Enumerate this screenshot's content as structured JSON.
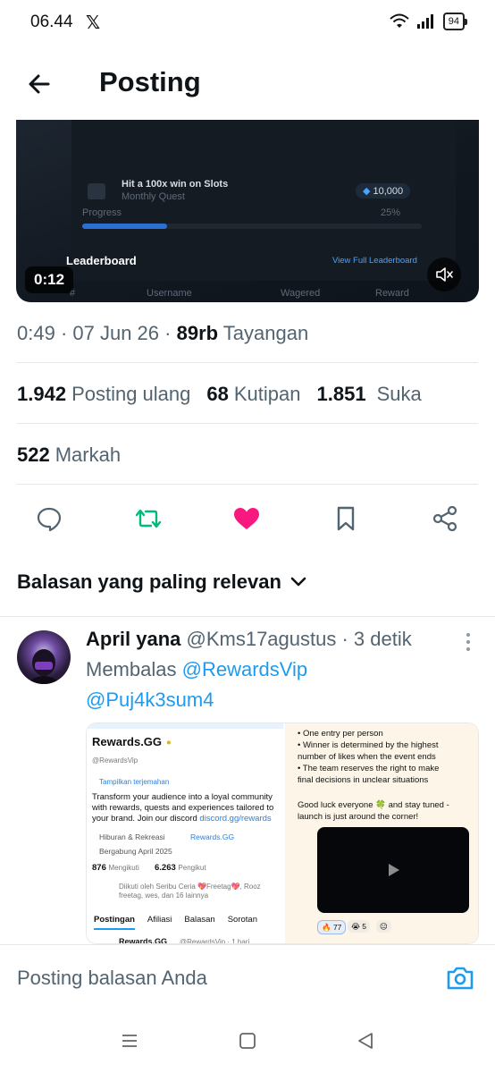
{
  "status_bar": {
    "time": "06.44",
    "app_icon": "x-logo-icon",
    "battery": "94"
  },
  "header": {
    "title": "Posting",
    "back_icon": "arrow-left-icon"
  },
  "video": {
    "overlay_texts": {
      "quest_title": "Hit a 100x win on Slots",
      "quest_sub": "Monthly Quest",
      "reward": "10,000",
      "progress_label": "Progress",
      "progress_pct": "25%",
      "leaderboard": "Leaderboard",
      "view_full": "View Full Leaderboard",
      "col_hash": "#",
      "col_user": "Username",
      "col_wagered": "Wagered",
      "col_reward": "Reward"
    },
    "quest_progress": 0.25,
    "duration": "0:12",
    "mute_icon": "volume-mute-icon"
  },
  "post_meta": {
    "time": "0:49",
    "date": "07 Jun 26",
    "views_count": "89rb",
    "views_label": "Tayangan"
  },
  "stats": {
    "reposts_count": "1.942",
    "reposts_label": "Posting ulang",
    "quotes_count": "68",
    "quotes_label": "Kutipan",
    "likes_count": "1.851",
    "likes_label": "Suka",
    "bookmarks_count": "522",
    "bookmarks_label": "Markah"
  },
  "actions": [
    {
      "name": "reply",
      "icon": "comment-icon"
    },
    {
      "name": "repost",
      "icon": "repost-icon",
      "color": "#00ba7c"
    },
    {
      "name": "like",
      "icon": "heart-icon",
      "color": "#f91880"
    },
    {
      "name": "bookmark",
      "icon": "bookmark-icon"
    },
    {
      "name": "share",
      "icon": "share-icon"
    }
  ],
  "replies_sort": {
    "label": "Balasan yang paling relevan"
  },
  "reply": {
    "name": "April yana",
    "handle": "@Kms17agustus",
    "time": "3 detik",
    "replying_prefix": "Membalas",
    "mention_1": "@RewardsVip",
    "mention_2": "@Puj4k3sum4",
    "media": {
      "left": {
        "profile_name": "Rewards.GG",
        "profile_handle": "@RewardsVip",
        "translate": "Tampilkan terjemahan",
        "bio_1": "Transform your audience into a loyal community",
        "bio_2": "with rewards, quests and experiences tailored to",
        "bio_3": "your brand.  Join our discord",
        "bio_link": "discord.gg/rewards",
        "category": "Hiburan & Rekreasi",
        "website": "Rewards.GG",
        "joined": "Bergabung April 2025",
        "following_count": "876",
        "following_label": "Mengikuti",
        "followers_count": "6.263",
        "followers_label": "Pengikut",
        "followed_by": "Diikuti oleh Seribu Ceria 💖Freetag💖, Rooz freetag, wes, dan 16 lainnya",
        "tabs": [
          "Postingan",
          "Afiliasi",
          "Balasan",
          "Sorotan"
        ],
        "bottom_name": "Rewards.GG",
        "bottom_handle": "@RewardsVip · 1 hari"
      },
      "right": {
        "rule_1": "• One entry per person",
        "rule_2": "• Winner is determined by the highest",
        "rule_2b": "number of likes when the event ends",
        "rule_3": "• The team reserves the right to make",
        "rule_3b": "final decisions in unclear situations",
        "closing_1": "Good luck everyone 🍀 and stay tuned -",
        "closing_2": "launch is just around the corner!",
        "reaction_1": "🔥 77",
        "reaction_2": "😭 5",
        "reaction_3": "😐"
      }
    }
  },
  "reply_bar": {
    "placeholder": "Posting balasan Anda",
    "camera_icon": "camera-icon"
  },
  "nav_bar": {
    "icons": [
      "menu-icon",
      "home-square-icon",
      "back-triangle-icon"
    ]
  }
}
